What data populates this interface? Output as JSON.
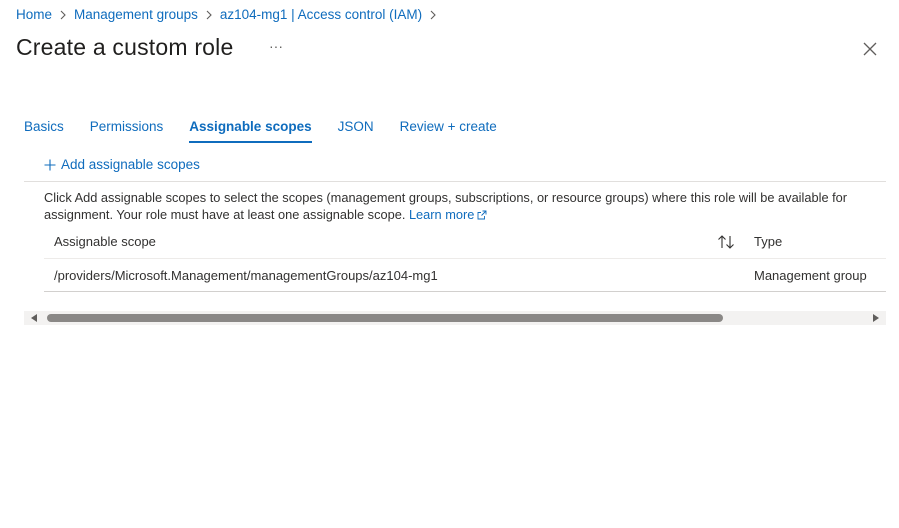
{
  "breadcrumb": {
    "items": [
      "Home",
      "Management groups",
      "az104-mg1 | Access control (IAM)"
    ],
    "separator_icon": "chevron-right-icon"
  },
  "header": {
    "title": "Create a custom role",
    "more_label": "···",
    "close_icon": "close-icon"
  },
  "tabs": [
    {
      "label": "Basics",
      "active": false
    },
    {
      "label": "Permissions",
      "active": false
    },
    {
      "label": "Assignable scopes",
      "active": true
    },
    {
      "label": "JSON",
      "active": false
    },
    {
      "label": "Review + create",
      "active": false
    }
  ],
  "command_bar": {
    "add_label": "Add assignable scopes",
    "add_icon": "plus-icon"
  },
  "description": {
    "text": "Click Add assignable scopes to select the scopes (management groups, subscriptions, or resource groups) where this role will be available for assignment. Your role must have at least one assignable scope.",
    "learn_more": "Learn more",
    "external_icon": "external-link-icon"
  },
  "table": {
    "columns": {
      "scope": "Assignable scope",
      "type": "Type"
    },
    "sort_icon": "sort-icon",
    "rows": [
      {
        "scope": "/providers/Microsoft.Management/managementGroups/az104-mg1",
        "type": "Management group"
      }
    ]
  },
  "colors": {
    "accent": "#0f6cbd",
    "text": "#323130",
    "divider": "#e1dfdd"
  }
}
